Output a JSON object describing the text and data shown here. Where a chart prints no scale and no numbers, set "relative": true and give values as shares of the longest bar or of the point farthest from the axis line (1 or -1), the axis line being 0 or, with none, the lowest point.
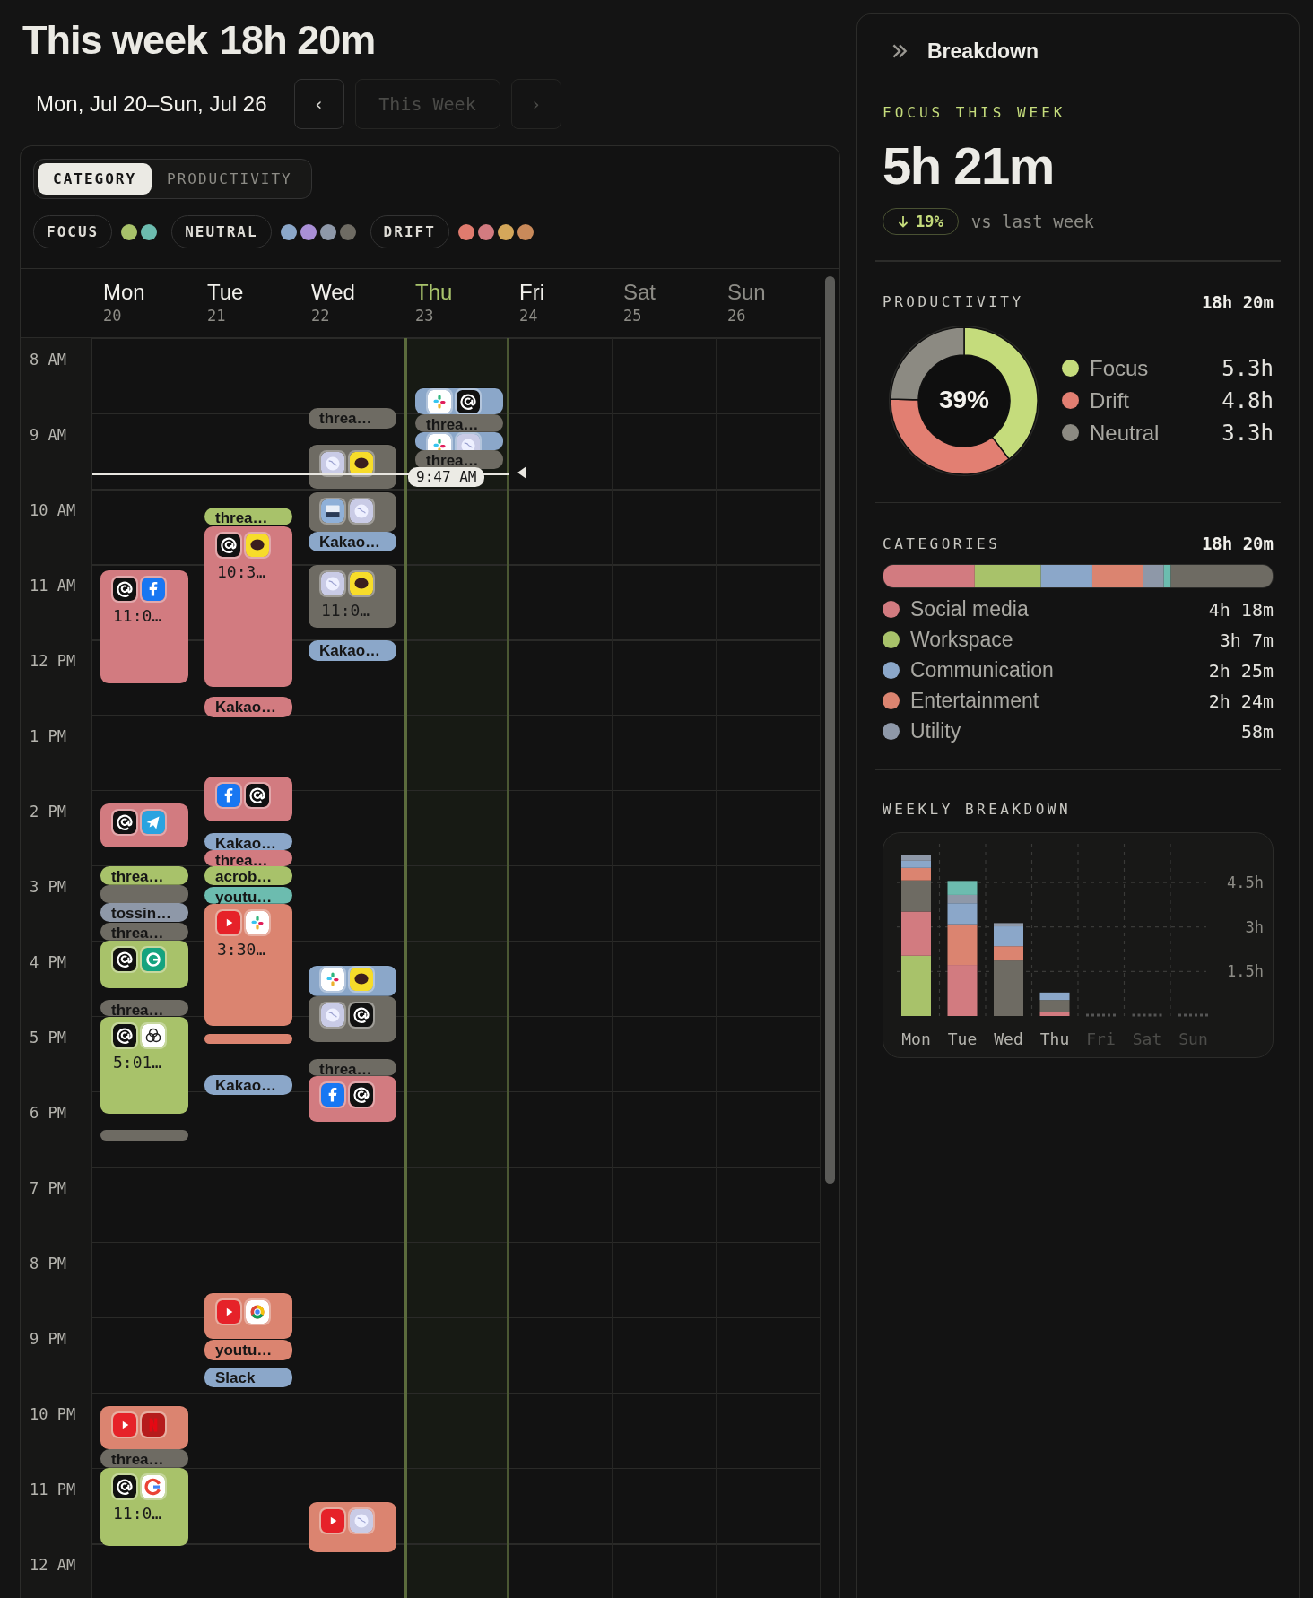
{
  "header": {
    "title": "This week",
    "total": "18h 20m",
    "range": "Mon, Jul 20–Sun, Jul 26"
  },
  "nav": [
    {
      "label": "‹",
      "disabled": false
    },
    {
      "label": "This Week",
      "disabled": true
    },
    {
      "label": "›",
      "disabled": true
    }
  ],
  "view_toggle": [
    {
      "label": "CATEGORY",
      "selected": true
    },
    {
      "label": "PRODUCTIVITY",
      "selected": false
    }
  ],
  "legend": [
    {
      "label": "FOCUS",
      "dots": [
        {
          "color": "#a8c26a"
        },
        {
          "color": "#6cbcaf"
        }
      ]
    },
    {
      "label": "NEUTRAL",
      "dots": [
        {
          "color": "#8ba7c9"
        },
        {
          "color": "#a98fd6"
        },
        {
          "color": "#8e98a8"
        },
        {
          "color": "#6e6b63"
        }
      ]
    },
    {
      "label": "DRIFT",
      "dots": [
        {
          "color": "#e07b6e"
        },
        {
          "color": "#d27b80"
        },
        {
          "color": "#d4a75a"
        },
        {
          "color": "#c98a5a"
        }
      ]
    }
  ],
  "hours": [
    "8 AM",
    "9 AM",
    "10 AM",
    "11 AM",
    "12 PM",
    "1 PM",
    "2 PM",
    "3 PM",
    "4 PM",
    "5 PM",
    "6 PM",
    "7 PM",
    "8 PM",
    "9 PM",
    "10 PM",
    "11 PM",
    "12 AM"
  ],
  "now": {
    "label": "9:47 AM"
  },
  "days": [
    {
      "name": "Mon",
      "date": "20",
      "today": false,
      "muted": false,
      "events": [
        {
          "kind": "block",
          "color": "#d27b80",
          "time": "11:0…"
        },
        {
          "kind": "block",
          "color": "#d27b80"
        },
        {
          "kind": "pill",
          "color": "#a8c26a",
          "label": "threa…"
        },
        {
          "kind": "block",
          "color": "#6e6b63"
        },
        {
          "kind": "pill",
          "color": "#8e98a8",
          "label": "tossin…"
        },
        {
          "kind": "pill",
          "color": "#6e6b63",
          "label": "threa…"
        },
        {
          "kind": "block",
          "color": "#a8c26a"
        },
        {
          "kind": "pill",
          "color": "#6e6b63",
          "label": "threa…"
        },
        {
          "kind": "block",
          "color": "#a8c26a",
          "time": "5:01…"
        },
        {
          "kind": "pill",
          "color": "#6e6b63"
        },
        {
          "kind": "block",
          "color": "#db8470"
        },
        {
          "kind": "pill",
          "color": "#6e6b63",
          "label": "threa…"
        },
        {
          "kind": "block",
          "color": "#a8c26a",
          "time": "11:0…"
        }
      ]
    },
    {
      "name": "Tue",
      "date": "21",
      "today": false,
      "muted": false,
      "events": [
        {
          "kind": "pill",
          "color": "#a8c26a",
          "label": "threa…"
        },
        {
          "kind": "block",
          "color": "#d27b80",
          "time": "10:3…"
        },
        {
          "kind": "pill",
          "color": "#d27b80",
          "label": "Kakao…"
        },
        {
          "kind": "block",
          "color": "#d27b80"
        },
        {
          "kind": "pill",
          "color": "#8ba7c9",
          "label": "Kakao…"
        },
        {
          "kind": "pill",
          "color": "#d27b80",
          "label": "threa…"
        },
        {
          "kind": "pill",
          "color": "#a8c26a",
          "label": "acrob…"
        },
        {
          "kind": "pill",
          "color": "#6cbcaf",
          "label": "youtu…"
        },
        {
          "kind": "block",
          "color": "#db8470",
          "time": "3:30…"
        },
        {
          "kind": "pill",
          "color": "#db8470"
        },
        {
          "kind": "pill",
          "color": "#8ba7c9",
          "label": "Kakao…"
        },
        {
          "kind": "block",
          "color": "#db8470"
        },
        {
          "kind": "pill",
          "color": "#db8470",
          "label": "youtu…"
        },
        {
          "kind": "pill",
          "color": "#8ba7c9",
          "label": "Slack"
        }
      ]
    },
    {
      "name": "Wed",
      "date": "22",
      "today": false,
      "muted": false,
      "events": [
        {
          "kind": "pill",
          "color": "#6e6b63",
          "label": "threa…"
        },
        {
          "kind": "block",
          "color": "#6e6b63"
        },
        {
          "kind": "block",
          "color": "#6e6b63"
        },
        {
          "kind": "pill",
          "color": "#8ba7c9",
          "label": "Kakao…"
        },
        {
          "kind": "block",
          "color": "#6e6b63",
          "time": "11:0…"
        },
        {
          "kind": "pill",
          "color": "#8ba7c9",
          "label": "Kakao…"
        },
        {
          "kind": "block",
          "color": "#8ba7c9"
        },
        {
          "kind": "block",
          "color": "#6e6b63"
        },
        {
          "kind": "pill",
          "color": "#6e6b63",
          "label": "threa…"
        },
        {
          "kind": "block",
          "color": "#d27b80"
        },
        {
          "kind": "block",
          "color": "#db8470"
        }
      ]
    },
    {
      "name": "Thu",
      "date": "23",
      "today": true,
      "muted": false,
      "events": [
        {
          "kind": "block",
          "color": "#8ba7c9"
        },
        {
          "kind": "pill",
          "color": "#6e6b63",
          "label": "threa…"
        },
        {
          "kind": "block",
          "color": "#8ba7c9"
        },
        {
          "kind": "pill",
          "color": "#6e6b63",
          "label": "threa…"
        }
      ]
    },
    {
      "name": "Fri",
      "date": "24",
      "today": false,
      "muted": false
    },
    {
      "name": "Sat",
      "date": "25",
      "today": false,
      "muted": true
    },
    {
      "name": "Sun",
      "date": "26",
      "today": false,
      "muted": true
    }
  ],
  "breakdown": {
    "title": "Breakdown",
    "focus": {
      "label": "FOCUS THIS WEEK",
      "value": "5h 21m",
      "change": "19%",
      "comparison": "vs last week"
    },
    "productivity": {
      "label": "PRODUCTIVITY",
      "total": "18h 20m",
      "center": "39%",
      "chart_data": {
        "type": "donut",
        "values": [
          39.55,
          35.82,
          24.63
        ]
      },
      "legend": [
        {
          "label": "Focus",
          "value": "5.3h",
          "color": "#c5dc7c"
        },
        {
          "label": "Drift",
          "value": "4.8h",
          "color": "#e27f72"
        },
        {
          "label": "Neutral",
          "value": "3.3h",
          "color": "#8c8a82"
        }
      ]
    },
    "categories": {
      "label": "CATEGORIES",
      "total": "18h 20m",
      "chart_data": {
        "type": "bar",
        "orientation": "horizontal",
        "stacked": true,
        "relative": true,
        "series": [
          {
            "color": "#d27b80",
            "values": [
              0.2346
            ]
          },
          {
            "color": "#a8c26a",
            "values": [
              0.1702
            ]
          },
          {
            "color": "#8ba7c9",
            "values": [
              0.132
            ]
          },
          {
            "color": "#db8470",
            "values": [
              0.1309
            ]
          },
          {
            "color": "#8e98a8",
            "values": [
              0.0529
            ]
          },
          {
            "color": "#6cbcaf",
            "values": [
              0.018
            ]
          },
          {
            "color": "#6e6b63",
            "values": [
              0.2614
            ]
          }
        ]
      },
      "items": [
        {
          "label": "Social media",
          "value": "4h 18m",
          "color": "#d27b80"
        },
        {
          "label": "Workspace",
          "value": "3h 7m",
          "color": "#a8c26a"
        },
        {
          "label": "Communication",
          "value": "2h 25m",
          "color": "#8ba7c9"
        },
        {
          "label": "Entertainment",
          "value": "2h 24m",
          "color": "#db8470"
        },
        {
          "label": "Utility",
          "value": "58m",
          "color": "#8e98a8"
        }
      ]
    },
    "weekly": {
      "label": "WEEKLY BREAKDOWN",
      "chart_data": {
        "type": "bar",
        "stacked": true,
        "categories": [
          "Mon",
          "Tue",
          "Wed",
          "Thu",
          "Fri",
          "Sat",
          "Sun"
        ],
        "ylim": [
          0,
          5.8
        ],
        "grid": true,
        "yticks": [
          {
            "value": 1.5,
            "label": "1.5h"
          },
          {
            "value": 3,
            "label": "3h"
          },
          {
            "value": 4.5,
            "label": "4.5h"
          }
        ],
        "series": [
          {
            "color": "#a8c26a",
            "values": [
              2.03,
              0,
              0,
              0,
              0,
              0,
              0
            ]
          },
          {
            "color": "#d27b80",
            "values": [
              1.49,
              1.72,
              0,
              0.13,
              0,
              0,
              0
            ]
          },
          {
            "color": "#6e6b63",
            "values": [
              1.05,
              0,
              1.87,
              0.41,
              0,
              0,
              0
            ]
          },
          {
            "color": "#db8470",
            "values": [
              0.42,
              1.37,
              0.48,
              0,
              0,
              0,
              0
            ]
          },
          {
            "color": "#8ba7c9",
            "values": [
              0.24,
              0.71,
              0.67,
              0.25,
              0,
              0,
              0
            ]
          },
          {
            "color": "#8e98a8",
            "values": [
              0.19,
              0.28,
              0.11,
              0,
              0,
              0,
              0
            ]
          },
          {
            "color": "#6cbcaf",
            "values": [
              0,
              0.47,
              0,
              0,
              0,
              0,
              0
            ]
          }
        ]
      }
    }
  }
}
